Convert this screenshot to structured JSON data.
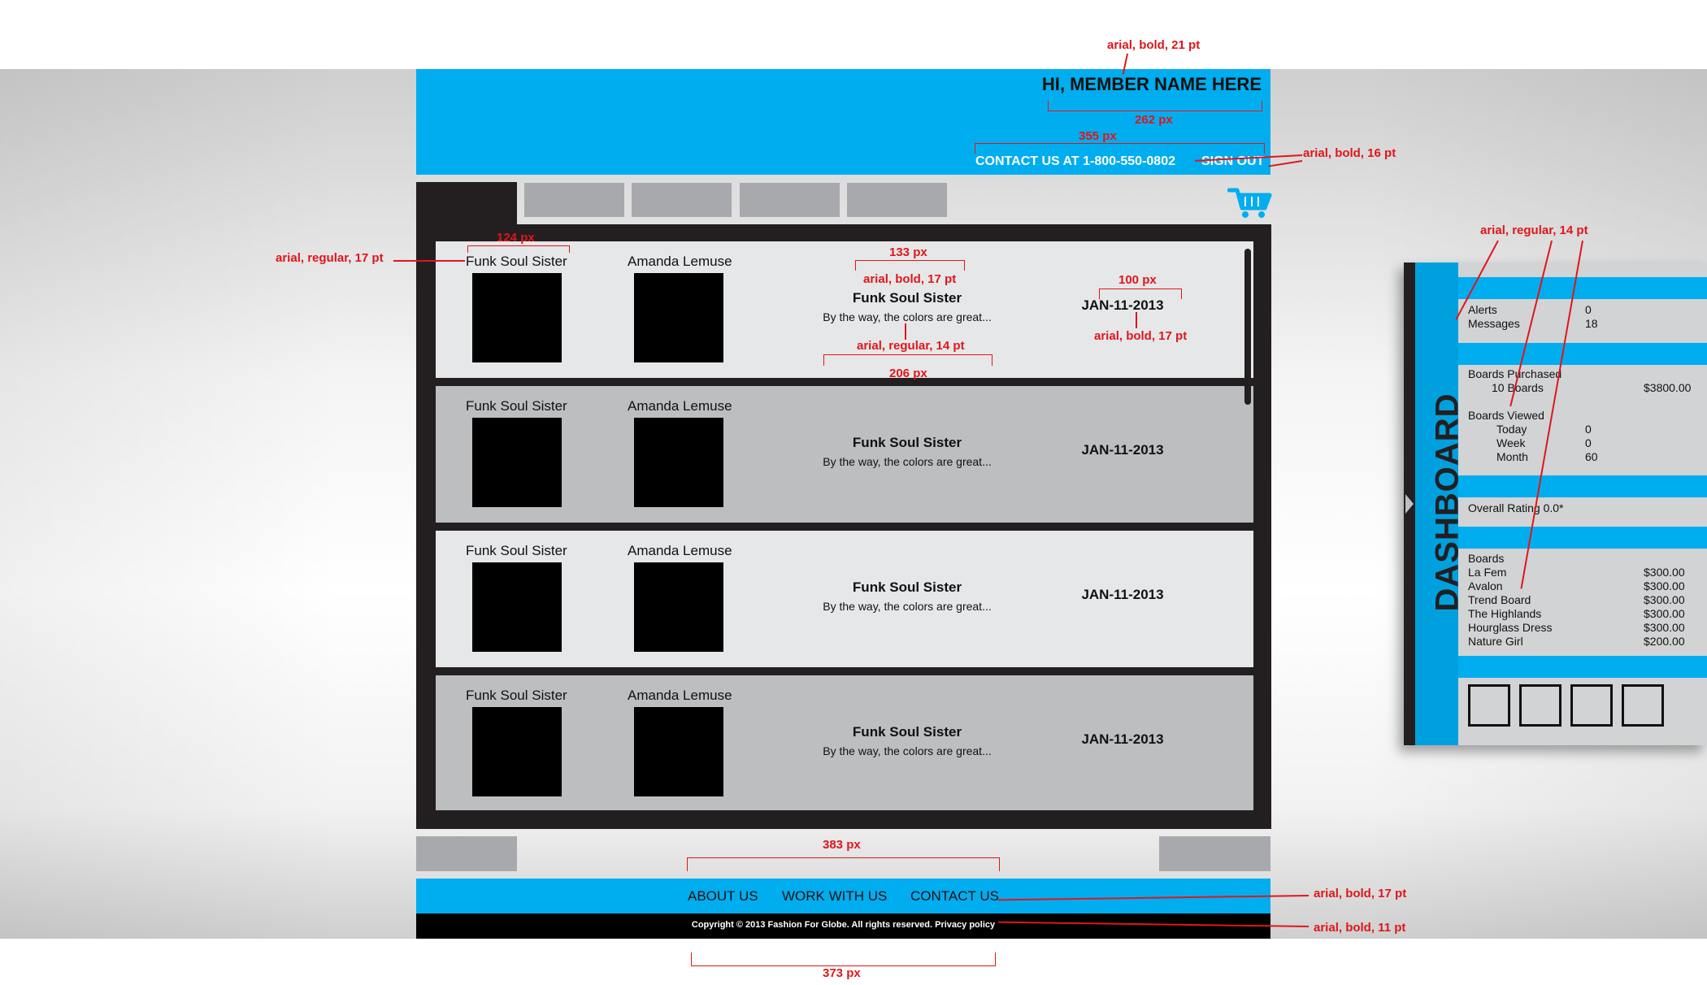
{
  "annotations": {
    "header_font": "arial, bold, 21 pt",
    "greeting_width": "262 px",
    "contact_width": "355 px",
    "contact_font": "arial, bold, 16 pt",
    "name_width": "124 px",
    "name_font": "arial, regular, 17 pt",
    "title_width": "133 px",
    "title_font": "arial, bold, 17 pt",
    "snippet_font": "arial, regular, 14 pt",
    "snippet_width": "206 px",
    "date_width": "100 px",
    "date_font": "arial, bold, 17 pt",
    "dash_font": "arial, regular, 14 pt",
    "footer_width": "383 px",
    "footer_font": "arial, bold, 17 pt",
    "copyright_font": "arial, bold, 11 pt",
    "copyright_width": "373 px"
  },
  "header": {
    "greeting": "HI, MEMBER NAME HERE",
    "contact": "CONTACT US AT 1-800-550-0802",
    "sign_out": "SIGN OUT"
  },
  "rows": [
    {
      "name1": "Funk Soul Sister",
      "name2": "Amanda Lemuse",
      "title": "Funk Soul Sister",
      "snippet": "By the way, the colors are great...",
      "date": "JAN-11-2013"
    },
    {
      "name1": "Funk Soul Sister",
      "name2": "Amanda Lemuse",
      "title": "Funk Soul Sister",
      "snippet": "By the way, the colors are great...",
      "date": "JAN-11-2013"
    },
    {
      "name1": "Funk Soul Sister",
      "name2": "Amanda Lemuse",
      "title": "Funk Soul Sister",
      "snippet": "By the way, the colors are great...",
      "date": "JAN-11-2013"
    },
    {
      "name1": "Funk Soul Sister",
      "name2": "Amanda Lemuse",
      "title": "Funk Soul Sister",
      "snippet": "By the way, the colors are great...",
      "date": "JAN-11-2013"
    }
  ],
  "footer": {
    "about": "ABOUT US",
    "work": "WORK WITH US",
    "contact": "CONTACT US",
    "copyright": "Copyright © 2013 Fashion For Globe. All rights reserved. Privacy policy"
  },
  "dashboard": {
    "label": "DASHBOARD",
    "alerts_label": "Alerts",
    "alerts_value": "0",
    "messages_label": "Messages",
    "messages_value": "18",
    "purchased_label": "Boards Purchased",
    "purchased_count": "10 Boards",
    "purchased_total": "$3800.00",
    "viewed_label": "Boards Viewed",
    "today_label": "Today",
    "today_value": "0",
    "week_label": "Week",
    "week_value": "0",
    "month_label": "Month",
    "month_value": "60",
    "rating": "Overall Rating 0.0*",
    "boards_label": "Boards",
    "boards": [
      {
        "name": "La Fem",
        "price": "$300.00"
      },
      {
        "name": "Avalon",
        "price": "$300.00"
      },
      {
        "name": "Trend Board",
        "price": "$300.00"
      },
      {
        "name": "The Highlands",
        "price": "$300.00"
      },
      {
        "name": "Hourglass Dress",
        "price": "$300.00"
      },
      {
        "name": "Nature Girl",
        "price": "$200.00"
      }
    ]
  },
  "colors": {
    "brand_blue": "#00adef",
    "dark": "#231f20",
    "annotation_red": "#e0161b"
  }
}
